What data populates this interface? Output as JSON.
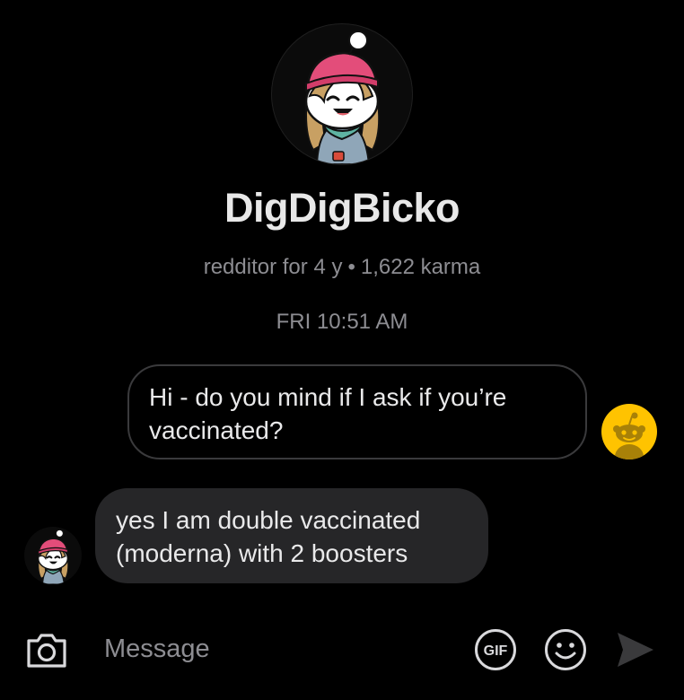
{
  "profile": {
    "username": "DigDigBicko",
    "account_age": "redditor for 4 y",
    "separator": "•",
    "karma": "1,622 karma",
    "avatar_icon": "snoo-avatar-pink-beanie-icon"
  },
  "conversation": {
    "timestamp": "FRI 10:51 AM",
    "messages": [
      {
        "direction": "outgoing",
        "text": "Hi - do you mind if I ask if you’re vaccinated?",
        "avatar_icon": "default-snoo-avatar-yellow-icon"
      },
      {
        "direction": "incoming",
        "text": "yes I am double vaccinated (moderna) with 2 boosters",
        "avatar_icon": "snoo-avatar-pink-beanie-icon"
      }
    ]
  },
  "composer": {
    "placeholder": "Message",
    "value": "",
    "icons": {
      "camera": "camera-icon",
      "gif": "gif-icon",
      "emoji": "smiley-face-icon",
      "send": "send-arrow-icon"
    }
  },
  "colors": {
    "background": "#000000",
    "text_primary": "#e9e9ea",
    "text_secondary": "#8d8d92",
    "incoming_bubble": "#262628",
    "outgoing_border": "#3a3a3c",
    "default_avatar_yellow": "#ffc300"
  }
}
